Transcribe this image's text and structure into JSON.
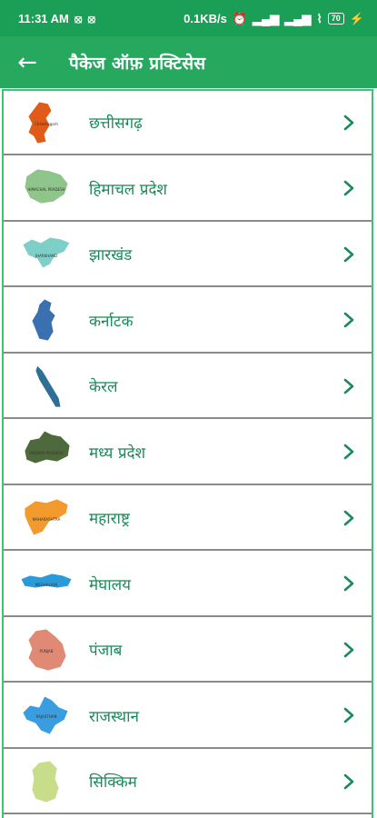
{
  "status_bar": {
    "time": "11:31 AM",
    "net_speed": "0.1KB/s",
    "battery": "70"
  },
  "app_bar": {
    "title": "पैकेज ऑफ़ प्रक्टिसेस"
  },
  "colors": {
    "status_bar": "#1b9e55",
    "app_bar": "#26a85f",
    "label_text": "#1a8a5a",
    "chevron": "#1a8a5a"
  },
  "states": [
    {
      "label": "छत्तीसगढ़",
      "map_icon": "chhattisgarh-map-icon",
      "map_color": "#e05a1a",
      "map_text": "Chhattisgarh"
    },
    {
      "label": "हिमाचल प्रदेश",
      "map_icon": "himachal-pradesh-map-icon",
      "map_color": "#8fc48a",
      "map_text": "HIMACHAL PRADESH"
    },
    {
      "label": "झारखंड",
      "map_icon": "jharkhand-map-icon",
      "map_color": "#7fcfc9",
      "map_text": "JHARKHAND"
    },
    {
      "label": "कर्नाटक",
      "map_icon": "karnataka-map-icon",
      "map_color": "#3a6fb0",
      "map_text": ""
    },
    {
      "label": "केरल",
      "map_icon": "kerala-map-icon",
      "map_color": "#2e6f96",
      "map_text": ""
    },
    {
      "label": "मध्य प्रदेश",
      "map_icon": "madhya-pradesh-map-icon",
      "map_color": "#4e6a3c",
      "map_text": "MADHYA PRADESH"
    },
    {
      "label": "महाराष्ट्र",
      "map_icon": "maharashtra-map-icon",
      "map_color": "#f29a2c",
      "map_text": "MAHARASHTRA"
    },
    {
      "label": "मेघालय",
      "map_icon": "meghalaya-map-icon",
      "map_color": "#2a9bd8",
      "map_text": "MEGHALAYA"
    },
    {
      "label": "पंजाब",
      "map_icon": "punjab-map-icon",
      "map_color": "#e08a76",
      "map_text": "PUNJAB"
    },
    {
      "label": "राजस्थान",
      "map_icon": "rajasthan-map-icon",
      "map_color": "#3a9de0",
      "map_text": "RAJASTHAN"
    },
    {
      "label": "सिक्किम",
      "map_icon": "sikkim-map-icon",
      "map_color": "#c8dd8a",
      "map_text": ""
    }
  ]
}
